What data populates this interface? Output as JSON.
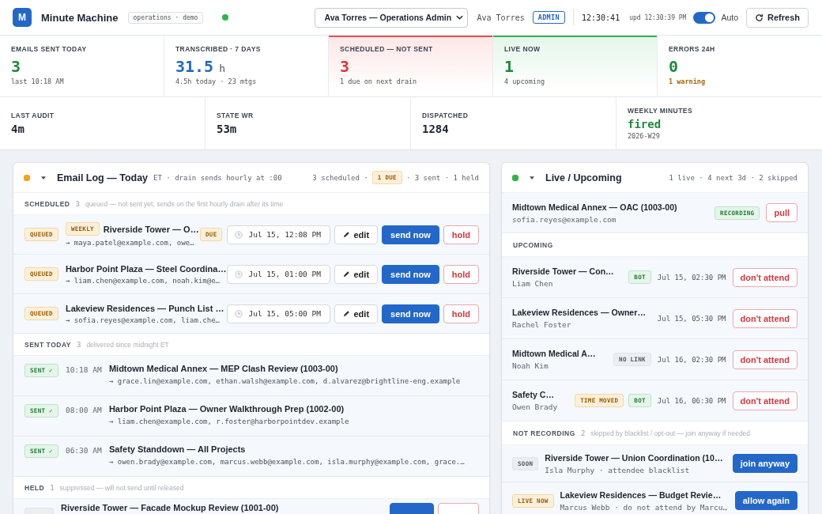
{
  "header": {
    "logo": "M",
    "app_name": "Minute Machine",
    "env_tag": "operations · demo",
    "connected": true,
    "account_select": "Ava Torres — Operations Admin",
    "user_name": "Ava Torres",
    "role": "ADMIN",
    "clock": "12:30:41",
    "updated": "upd 12:30:39 PM",
    "auto_refresh": {
      "label": "Auto",
      "on": true
    },
    "refresh_button": "Refresh"
  },
  "stats": [
    {
      "label": "EMAILS SENT TODAY",
      "value": "3",
      "note": {
        "text": "last 10:18 AM",
        "kind": "plain"
      },
      "kind": "good",
      "highlighted": false
    },
    {
      "label": "TRANSCRIBED · 7 DAYS",
      "value": "31.5",
      "unit": "h",
      "note": {
        "text": "4.5h today · 23 mtgs",
        "kind": "plain"
      },
      "kind": "info",
      "highlighted": false
    },
    {
      "label": "SCHEDULED — NOT SENT",
      "value": "3",
      "note": {
        "text": "1 due on next drain",
        "kind": "plain"
      },
      "kind": "bad",
      "highlighted": true
    },
    {
      "label": "LIVE NOW",
      "value": "1",
      "note": {
        "text": "4 upcoming",
        "kind": "plain"
      },
      "kind": "good",
      "highlighted": true
    },
    {
      "label": "ERRORS 24H",
      "value": "0",
      "note": {
        "text": "1 warning",
        "kind": "warning"
      },
      "kind": "good",
      "highlighted": false
    }
  ],
  "system": [
    {
      "label": "LAST AUDIT",
      "value": "4m",
      "kind": "plain"
    },
    {
      "label": "STATE WR",
      "value": "53m",
      "kind": "plain"
    },
    {
      "label": "DISPATCHED",
      "value": "1284",
      "kind": "plain"
    },
    {
      "label": "WEEKLY MINUTES",
      "value": "fired",
      "note": "2026-W29",
      "kind": "good"
    }
  ],
  "email_log": {
    "color": "#f2a31b",
    "expanded": true,
    "title": "Email Log — Today",
    "subtitle": "ET · drain sends hourly at :00",
    "summary_before": "3 scheduled ·",
    "summary_badge": {
      "text": "1 DUE",
      "kind": "warning"
    },
    "summary_after": "· 3 sent · 1 held",
    "sections": [
      {
        "kind": "scheduled",
        "title": "SCHEDULED",
        "count": "3",
        "note": "queued — not sent yet; sends on the first hourly drain after its time",
        "rows": [
          {
            "status": {
              "text": "QUEUED",
              "kind": "warning"
            },
            "tag": {
              "text": "WEEKLY",
              "kind": "warning"
            },
            "title": "Riverside Tower — O…",
            "recipients": "→ maya.patel@example.com, owe…",
            "flag": {
              "text": "DUE",
              "kind": "warning"
            },
            "send_time": "Jul 15, 12:08 PM",
            "actions": [
              {
                "kind": "edit",
                "label": "edit"
              },
              {
                "kind": "primary",
                "label": "send now"
              },
              {
                "kind": "danger",
                "label": "hold"
              }
            ]
          },
          {
            "status": {
              "text": "QUEUED",
              "kind": "warning"
            },
            "title": "Harbor Point Plaza — Steel Coordina…",
            "recipients": "→ liam.chen@example.com, noah.kim@e…",
            "send_time": "Jul 15, 01:00 PM",
            "actions": [
              {
                "kind": "edit",
                "label": "edit"
              },
              {
                "kind": "primary",
                "label": "send now"
              },
              {
                "kind": "danger",
                "label": "hold"
              }
            ]
          },
          {
            "status": {
              "text": "QUEUED",
              "kind": "warning"
            },
            "title": "Lakeview Residences — Punch List …",
            "recipients": "→ sofia.reyes@example.com, liam.che…",
            "send_time": "Jul 15, 05:00 PM",
            "actions": [
              {
                "kind": "edit",
                "label": "edit"
              },
              {
                "kind": "primary",
                "label": "send now"
              },
              {
                "kind": "danger",
                "label": "hold"
              }
            ]
          }
        ]
      },
      {
        "kind": "sent",
        "title": "SENT TODAY",
        "count": "3",
        "note": "delivered since midnight ET",
        "rows": [
          {
            "status": {
              "text": "SENT ✓",
              "kind": "success"
            },
            "time": "10:18 AM",
            "title": "Midtown Medical Annex — MEP Clash Review (1003-00)",
            "recipients": "→ grace.lin@example.com, ethan.walsh@example.com, d.alvarez@brightline-eng.example"
          },
          {
            "status": {
              "text": "SENT ✓",
              "kind": "success"
            },
            "time": "08:00 AM",
            "title": "Harbor Point Plaza — Owner Walkthrough Prep (1002-00)",
            "recipients": "→ liam.chen@example.com, r.foster@harborpointdev.example"
          },
          {
            "status": {
              "text": "SENT ✓",
              "kind": "success"
            },
            "time": "06:30 AM",
            "title": "Safety Standdown — All Projects",
            "recipients": "→ owen.brady@example.com, marcus.webb@example.com, isla.murphy@example.com, grace.…"
          }
        ]
      },
      {
        "kind": "held",
        "title": "HELD",
        "count": "1",
        "note": "suppressed — will not send until released",
        "rows": [
          {
            "status": {
              "kind": "neutral"
            },
            "title": "Riverside Tower — Facade Mockup Review (1001-00)",
            "actions": [
              {
                "kind": "primary"
              },
              {
                "kind": "danger"
              }
            ]
          }
        ]
      }
    ]
  },
  "live_panel": {
    "color": "#2fb34a",
    "expanded": true,
    "title": "Live / Upcoming",
    "summary": "1 live · 4 next 3d · 2 skipped",
    "live": [
      {
        "title": "Midtown Medical Annex — OAC (1003-00)",
        "subtitle": "sofia.reyes@example.com",
        "badges": [
          {
            "text": "RECORDING",
            "kind": "success"
          }
        ],
        "action": {
          "kind": "danger",
          "label": "pull"
        }
      }
    ],
    "sections": [
      {
        "kind": "upcoming",
        "title": "UPCOMING",
        "rows": [
          {
            "title": "Riverside Tower — Con…",
            "subtitle": "Liam Chen",
            "badges": [
              {
                "text": "BOT",
                "kind": "success"
              }
            ],
            "time": "Jul 15, 02:30 PM",
            "action": {
              "kind": "danger",
              "label": "don't attend"
            }
          },
          {
            "title": "Lakeview Residences — Owner…",
            "subtitle": "Rachel Foster",
            "time": "Jul 15, 05:30 PM",
            "action": {
              "kind": "danger",
              "label": "don't attend"
            }
          },
          {
            "title": "Midtown Medical A…",
            "subtitle": "Noah Kim",
            "badges": [
              {
                "text": "NO LINK",
                "kind": "neutral"
              }
            ],
            "time": "Jul 16, 02:30 PM",
            "action": {
              "kind": "danger",
              "label": "don't attend"
            }
          },
          {
            "title": "Safety C…",
            "subtitle": "Owen Brady",
            "badges": [
              {
                "text": "TIME MOVED",
                "kind": "warning"
              },
              {
                "text": "BOT",
                "kind": "success"
              }
            ],
            "time": "Jul 16, 06:30 PM",
            "action": {
              "kind": "danger",
              "label": "don't attend"
            }
          }
        ]
      },
      {
        "kind": "skipped",
        "title": "NOT RECORDING",
        "count": "2",
        "note": "skipped by blacklist / opt-out — join anyway if needed",
        "rows": [
          {
            "badge": {
              "text": "SOON",
              "kind": "neutral"
            },
            "title": "Riverside Tower — Union Coordination (10…",
            "subtitle": "Isla Murphy · attendee blacklist",
            "action": {
              "kind": "primary",
              "label": "join anyway"
            }
          },
          {
            "badge": {
              "text": "LIVE NOW",
              "kind": "warning"
            },
            "title": "Lakeview Residences — Budget Revie…",
            "subtitle": "Marcus Webb · do not attend by Marcu…",
            "action": {
              "kind": "primary",
              "label": "allow again"
            }
          }
        ]
      }
    ]
  }
}
